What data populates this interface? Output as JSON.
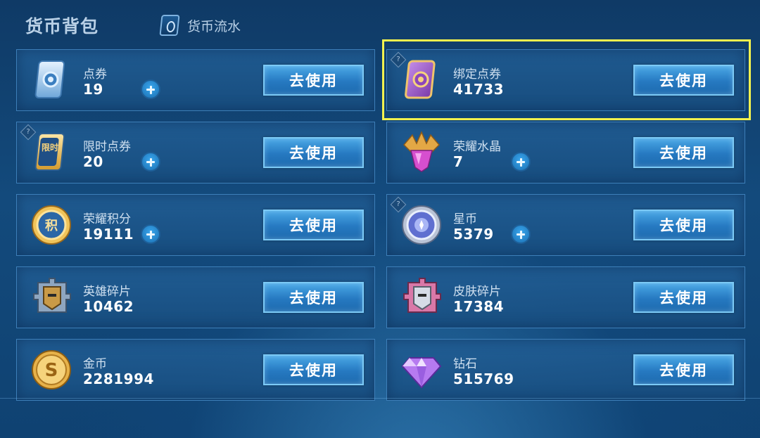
{
  "header": {
    "title": "货币背包",
    "flow_label": "货币流水"
  },
  "use_label": "去使用",
  "help_mark": "?",
  "currencies": [
    {
      "name": "点券",
      "count": "19",
      "icon": "ticket-icon",
      "has_plus": true,
      "has_help": false
    },
    {
      "name": "绑定点券",
      "count": "41733",
      "icon": "bound-ticket-icon",
      "has_plus": false,
      "has_help": true,
      "highlighted": true
    },
    {
      "name": "限时点券",
      "count": "20",
      "icon": "limited-ticket-icon",
      "icon_text": "限时",
      "has_plus": true,
      "has_help": true
    },
    {
      "name": "荣耀水晶",
      "count": "7",
      "icon": "glory-crystal-icon",
      "has_plus": true,
      "has_help": false
    },
    {
      "name": "荣耀积分",
      "count": "19111",
      "icon": "glory-points-icon",
      "icon_text": "积",
      "has_plus": true,
      "has_help": false
    },
    {
      "name": "星币",
      "count": "5379",
      "icon": "star-coin-icon",
      "has_plus": true,
      "has_help": true
    },
    {
      "name": "英雄碎片",
      "count": "10462",
      "icon": "hero-fragment-icon",
      "has_plus": false,
      "has_help": false
    },
    {
      "name": "皮肤碎片",
      "count": "17384",
      "icon": "skin-fragment-icon",
      "has_plus": false,
      "has_help": false
    },
    {
      "name": "金币",
      "count": "2281994",
      "icon": "gold-coin-icon",
      "icon_text": "S",
      "has_plus": false,
      "has_help": false
    },
    {
      "name": "钻石",
      "count": "515769",
      "icon": "diamond-icon",
      "has_plus": false,
      "has_help": false
    }
  ],
  "colors": {
    "highlight": "#f2f14e",
    "button": "#2679c1",
    "background": "#134a7c"
  }
}
